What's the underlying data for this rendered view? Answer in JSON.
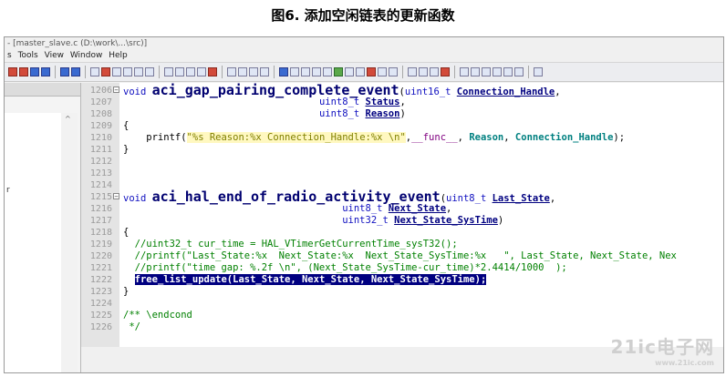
{
  "caption": "图6. 添加空闲链表的更新函数",
  "window": {
    "title": "- [master_slave.c (D:\\work\\...\\src)]",
    "menu": [
      "s",
      "Tools",
      "View",
      "Window",
      "Help"
    ]
  },
  "left_panel": {
    "scroll_arrow": "^",
    "fragment": "r"
  },
  "code_lines": [
    {
      "num": "1206",
      "fold": "−",
      "segments": [
        [
          "kw",
          "void "
        ],
        [
          "fn",
          "aci_gap_pairing_complete_event"
        ],
        [
          "pun",
          "("
        ],
        [
          "ty",
          "uint16_t "
        ],
        [
          "pm",
          "Connection_Handle"
        ],
        [
          "pun",
          ","
        ]
      ]
    },
    {
      "num": "1207",
      "segments": [
        [
          "pun",
          "                                  "
        ],
        [
          "ty",
          "uint8_t "
        ],
        [
          "pm",
          "Status"
        ],
        [
          "pun",
          ","
        ]
      ]
    },
    {
      "num": "1208",
      "segments": [
        [
          "pun",
          "                                  "
        ],
        [
          "ty",
          "uint8_t "
        ],
        [
          "pm",
          "Reason"
        ],
        [
          "pun",
          ")"
        ]
      ]
    },
    {
      "num": "1209",
      "segments": [
        [
          "pun",
          "{"
        ]
      ]
    },
    {
      "num": "1210",
      "segments": [
        [
          "pun",
          "    printf("
        ],
        [
          "str",
          "\"%s Reason:%x Connection_Handle:%x \\n\""
        ],
        [
          "pun",
          ","
        ],
        [
          "mac",
          "__func__"
        ],
        [
          "pun",
          ", "
        ],
        [
          "grn",
          "Reason"
        ],
        [
          "pun",
          ", "
        ],
        [
          "grn",
          "Connection_Handle"
        ],
        [
          "pun",
          ");"
        ]
      ]
    },
    {
      "num": "1211",
      "segments": [
        [
          "pun",
          "}"
        ]
      ]
    },
    {
      "num": "1212",
      "segments": []
    },
    {
      "num": "1213",
      "segments": []
    },
    {
      "num": "1214",
      "segments": []
    },
    {
      "num": "1215",
      "fold": "−",
      "segments": [
        [
          "kw",
          "void "
        ],
        [
          "fn",
          "aci_hal_end_of_radio_activity_event"
        ],
        [
          "pun",
          "("
        ],
        [
          "ty",
          "uint8_t "
        ],
        [
          "pm",
          "Last_State"
        ],
        [
          "pun",
          ","
        ]
      ]
    },
    {
      "num": "1216",
      "segments": [
        [
          "pun",
          "                                      "
        ],
        [
          "ty",
          "uint8_t "
        ],
        [
          "pm",
          "Next_State"
        ],
        [
          "pun",
          ","
        ]
      ]
    },
    {
      "num": "1217",
      "segments": [
        [
          "pun",
          "                                      "
        ],
        [
          "ty",
          "uint32_t "
        ],
        [
          "pm",
          "Next_State_SysTime"
        ],
        [
          "pun",
          ")"
        ]
      ]
    },
    {
      "num": "1218",
      "segments": [
        [
          "pun",
          "{"
        ]
      ]
    },
    {
      "num": "1219",
      "segments": [
        [
          "cmt",
          "  //uint32_t cur_time = HAL_VTimerGetCurrentTime_sysT32();"
        ]
      ]
    },
    {
      "num": "1220",
      "segments": [
        [
          "cmt",
          "  //printf(\"Last_State:%x  Next_State:%x  Next_State_SysTime:%x   \", Last_State, Next_State, Nex"
        ]
      ]
    },
    {
      "num": "1221",
      "segments": [
        [
          "cmt",
          "  //printf(\"time gap: %.2f \\n\", (Next_State_SysTime-cur_time)*2.4414/1000  );"
        ]
      ]
    },
    {
      "num": "1222",
      "segments": [
        [
          "pun",
          "  "
        ],
        [
          "sel",
          "free_list_update(Last_State, Next_State, Next_State_SysTime);"
        ]
      ]
    },
    {
      "num": "1223",
      "segments": [
        [
          "pun",
          "}"
        ]
      ]
    },
    {
      "num": "1224",
      "segments": []
    },
    {
      "num": "1225",
      "segments": [
        [
          "cmt",
          "/** \\endcond"
        ]
      ]
    },
    {
      "num": "1226",
      "segments": [
        [
          "cmt",
          " */"
        ]
      ]
    }
  ],
  "watermark": {
    "main": "21ic电子网",
    "sub": "www.21ic.com"
  }
}
